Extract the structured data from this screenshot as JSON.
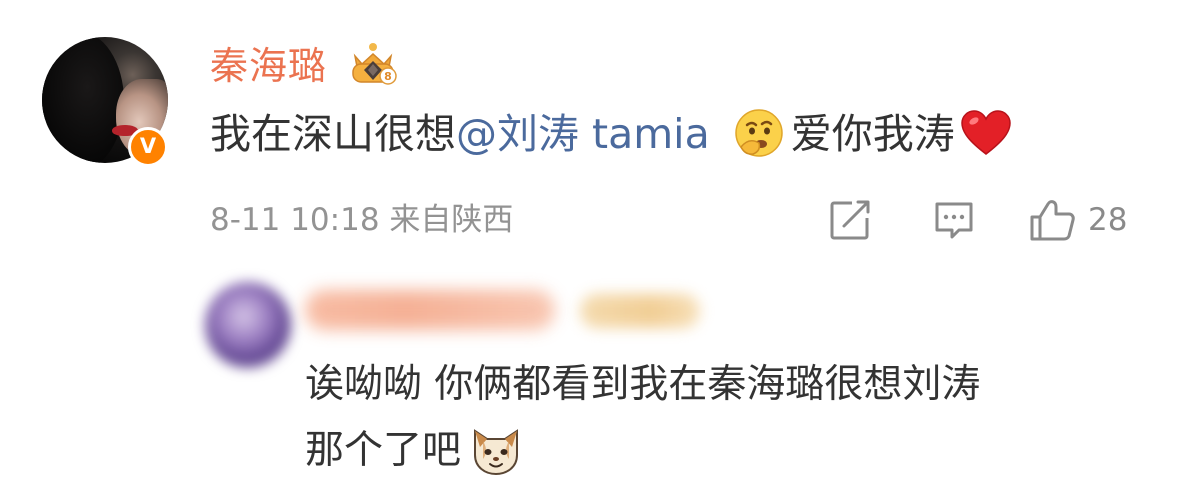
{
  "comment": {
    "username": "秦海璐",
    "verified_badge": "V",
    "text_before": "我在深山很想",
    "mention": "@刘涛 tamia",
    "text_after": "爱你我涛",
    "emojis": [
      "thinking-face-icon",
      "red-heart-icon"
    ],
    "meta": "8-11 10:18  来自陕西",
    "like_count": "28",
    "actions": [
      "repost-icon",
      "comment-icon",
      "like-icon"
    ]
  },
  "reply": {
    "text_line1": "诶呦呦 你俩都看到我在秦海璐很想刘涛",
    "text_line2": "那个了吧",
    "emoji": "cat-face-icon"
  },
  "colors": {
    "username": "#eb7350",
    "mention": "#4b6a9d",
    "verified_badge": "#ff8200",
    "body_text": "#333333",
    "meta_text": "#939393"
  }
}
